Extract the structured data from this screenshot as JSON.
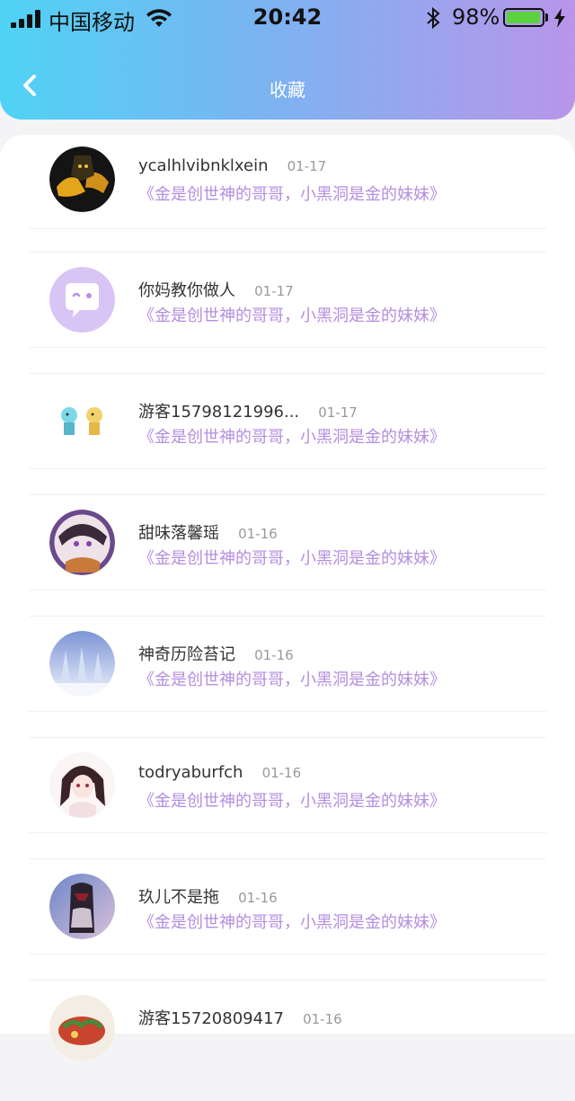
{
  "status_bar": {
    "carrier": "中国移动",
    "time": "20:42",
    "battery_percent": "98%",
    "battery_level": 0.98
  },
  "header": {
    "title": "收藏",
    "back_icon": "chevron-left-icon"
  },
  "colors": {
    "gradient_start": "#4fd3f5",
    "gradient_end": "#b995ea",
    "quote_color": "#b48ee0"
  },
  "favorites": [
    {
      "name": "ycalhlvibnklxein",
      "date": "01-17",
      "quote": "《金是创世神的哥哥，小黑洞是金的妹妹》"
    },
    {
      "name": "你妈教你做人",
      "date": "01-17",
      "quote": "《金是创世神的哥哥，小黑洞是金的妹妹》"
    },
    {
      "name": "游客15798121996...",
      "date": "01-17",
      "quote": "《金是创世神的哥哥，小黑洞是金的妹妹》"
    },
    {
      "name": "甜味落馨瑶",
      "date": "01-16",
      "quote": "《金是创世神的哥哥，小黑洞是金的妹妹》"
    },
    {
      "name": "神奇历险苔记",
      "date": "01-16",
      "quote": "《金是创世神的哥哥，小黑洞是金的妹妹》"
    },
    {
      "name": "todryaburfch",
      "date": "01-16",
      "quote": "《金是创世神的哥哥，小黑洞是金的妹妹》"
    },
    {
      "name": "玖儿不是拖",
      "date": "01-16",
      "quote": "《金是创世神的哥哥，小黑洞是金的妹妹》"
    },
    {
      "name": "游客15720809417",
      "date": "01-16",
      "quote": ""
    }
  ]
}
